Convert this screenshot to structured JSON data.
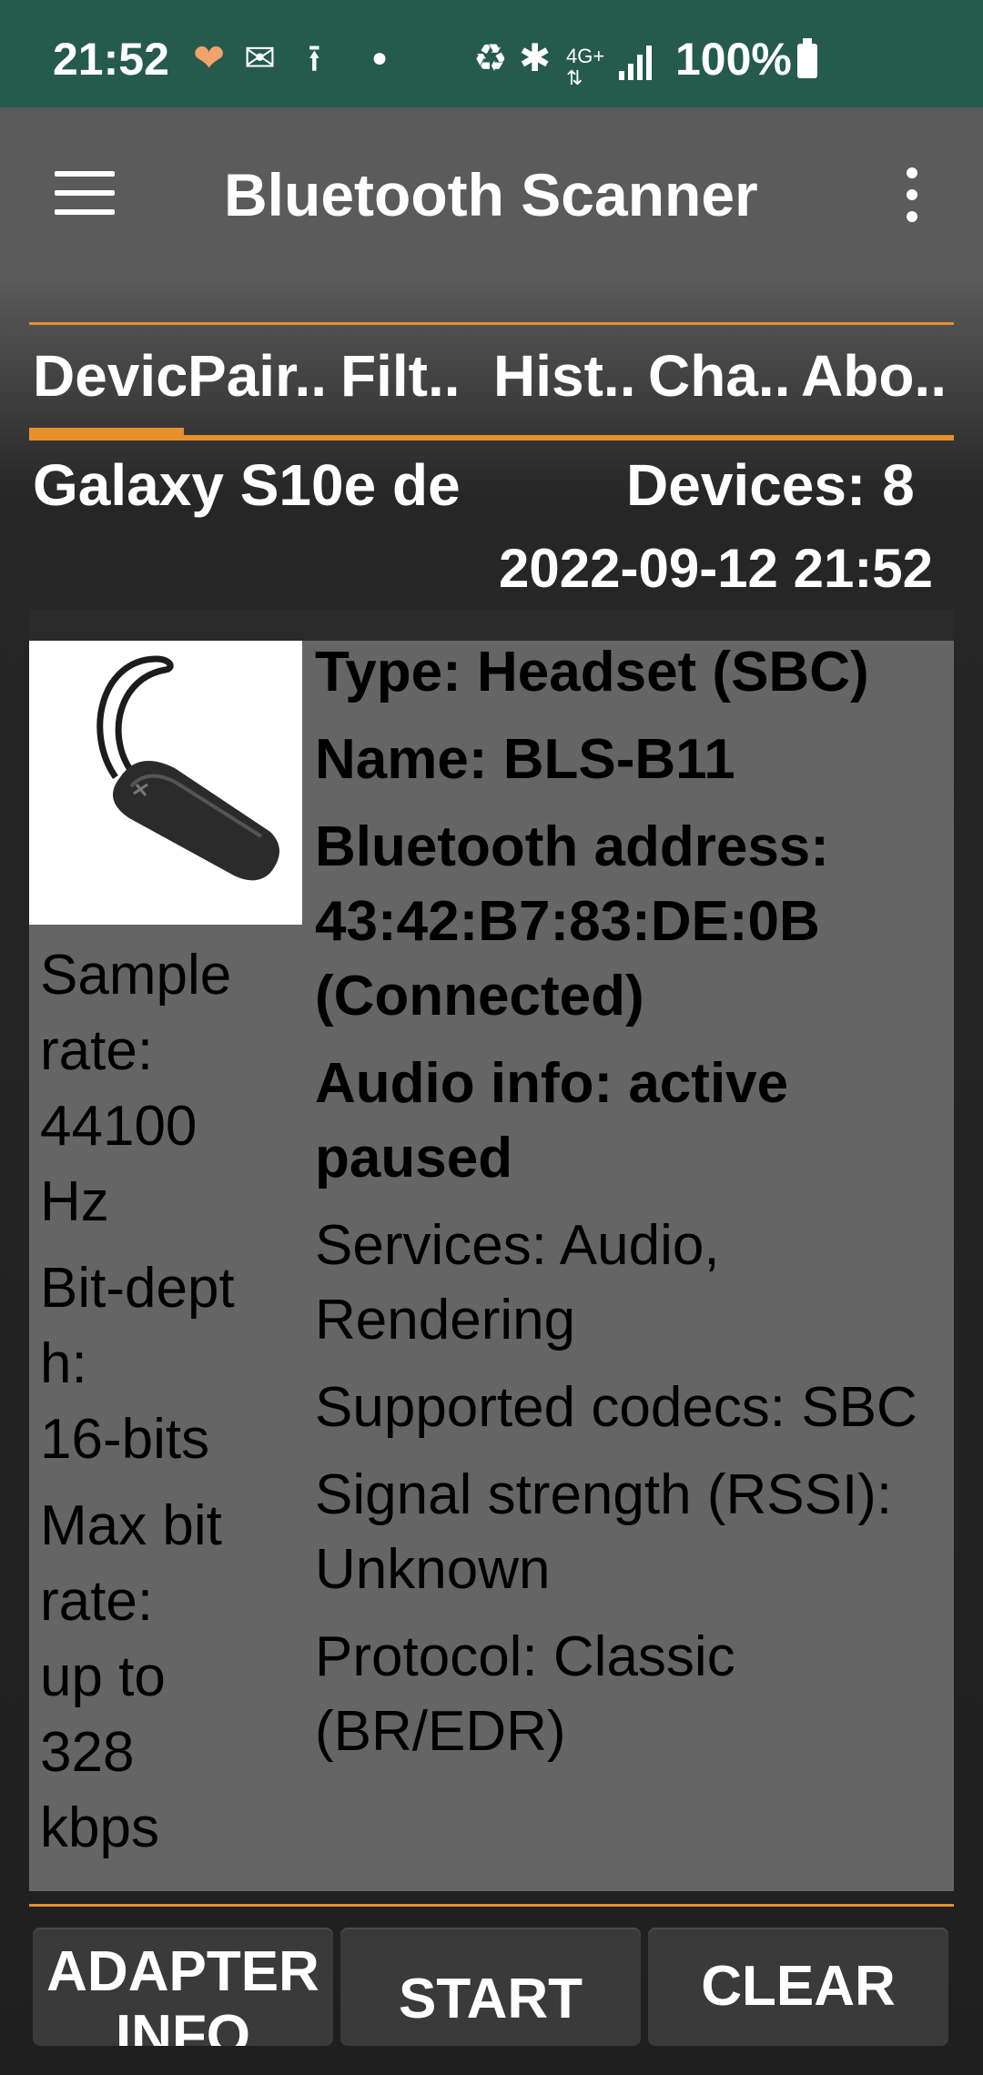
{
  "status_bar": {
    "time": "21:52",
    "battery": "100%",
    "icons": [
      "heart-rate-icon",
      "mail-icon",
      "upload-icon",
      "dot-icon",
      "battery-saver-icon",
      "bluetooth-icon",
      "4g-plus-icon",
      "signal-icon",
      "battery-icon"
    ]
  },
  "app_bar": {
    "title": "Bluetooth Scanner"
  },
  "tabs": [
    "Devic",
    "Pair..",
    "Filt..",
    "Hist..",
    "Cha..",
    "Abo.."
  ],
  "summary": {
    "device_name": "Galaxy S10e de",
    "device_count": "Devices: 8",
    "timestamp": "2022-09-12 21:52"
  },
  "device": {
    "image": "headset",
    "sample_rate_lines": [
      "Sample",
      "rate:",
      "44100",
      "Hz"
    ],
    "bit_depth_lines": [
      "Bit-dept",
      "h:",
      "16-bits"
    ],
    "max_bit_rate_lines": [
      "Max bit",
      "rate:",
      "up to",
      "328",
      "kbps"
    ],
    "type": "Type: Headset (SBC)",
    "name": "Name: BLS-B11",
    "address": "Bluetooth address: 43:42:B7:83:DE:0B (Connected)",
    "audio_info": "Audio info: active paused",
    "services": "Services: Audio, Rendering",
    "codecs": "Supported codecs: SBC",
    "signal": "Signal strength (RSSI): Unknown",
    "protocol": "Protocol: Classic (BR/EDR)"
  },
  "buttons": {
    "adapter_info": "ADAPTER INFO",
    "start": "START",
    "clear": "CLEAR"
  },
  "colors": {
    "status_bar": "#255b4c",
    "app_bar": "#5b5b5b",
    "accent": "#e8902c",
    "card": "#656565"
  }
}
